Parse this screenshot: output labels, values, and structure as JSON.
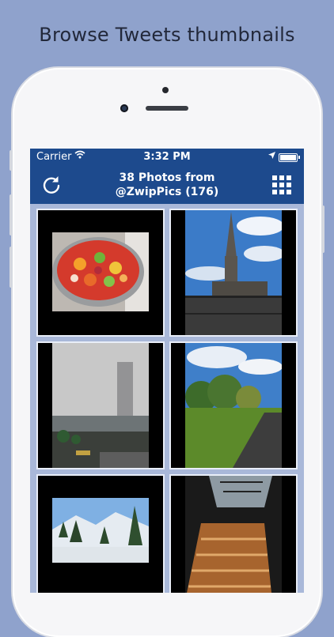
{
  "headline": "Browse Tweets thumbnails",
  "status_bar": {
    "carrier": "Carrier",
    "time": "3:32 PM",
    "wifi_icon": "wifi-icon",
    "location_icon": "location-arrow-icon",
    "battery_icon": "battery-icon"
  },
  "nav_bar": {
    "title_line1": "38 Photos from",
    "title_line2": "@ZwipPics (176)",
    "left_icon": "refresh-icon",
    "right_icon": "grid-icon"
  },
  "colors": {
    "background": "#8fa2cc",
    "nav": "#1d4a8d",
    "tile_border": "#e9eef8"
  },
  "thumbnails": [
    {
      "subject": "fruit salad bowl"
    },
    {
      "subject": "cathedral spire"
    },
    {
      "subject": "tower in fog"
    },
    {
      "subject": "country road"
    },
    {
      "subject": "snowy mountains with pines"
    },
    {
      "subject": "sunlit window shadows"
    }
  ]
}
